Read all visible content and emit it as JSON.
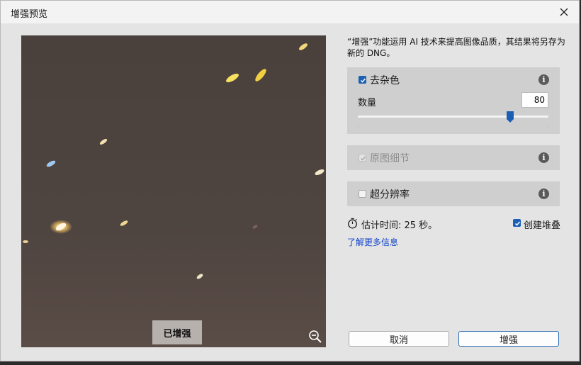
{
  "window": {
    "title": "增强预览",
    "accent_color": "#1a5fb4"
  },
  "preview": {
    "badge_label": "已增强",
    "zoom_icon": "zoom-out-icon"
  },
  "description": "“增强”功能运用 AI 技术来提高图像品质，其结果将另存为新的 DNG。",
  "denoise": {
    "label": "去杂色",
    "checked": true,
    "amount_label": "数量",
    "amount_value": "80",
    "slider_fraction": 0.8
  },
  "raw_details": {
    "label": "原图细节",
    "checked": true,
    "disabled": true
  },
  "super_resolution": {
    "label": "超分辨率",
    "checked": false
  },
  "estimate": {
    "text": "估计时间: 25 秒。"
  },
  "create_stack": {
    "label": "创建堆叠",
    "checked": true
  },
  "learn_more": "了解更多信息",
  "buttons": {
    "cancel": "取消",
    "enhance": "增强"
  }
}
